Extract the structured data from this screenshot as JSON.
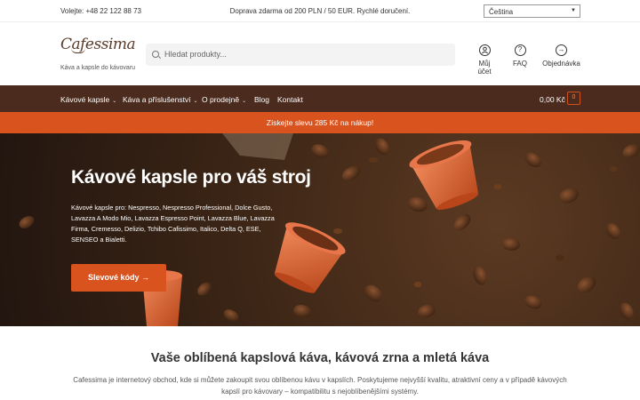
{
  "topbar": {
    "phone": "Volejte: +48 22 122 88 73",
    "shipping": "Doprava zdarma od 200 PLN / 50 EUR. Rychlé doručení.",
    "language": "Čeština"
  },
  "header": {
    "logo": "Cafessima",
    "tagline": "Káva a kapsle do kávovaru",
    "search_placeholder": "Hledat produkty...",
    "icons": [
      {
        "label": "Můj účet",
        "icon": "user-icon"
      },
      {
        "label": "FAQ",
        "icon": "question-icon"
      },
      {
        "label": "Objednávka",
        "icon": "arrow-right-icon"
      }
    ]
  },
  "nav": {
    "items": [
      {
        "label": "Kávové kapsle",
        "dropdown": true
      },
      {
        "label": "Káva a příslušenství",
        "dropdown": true
      },
      {
        "label": "O prodejně",
        "dropdown": true
      },
      {
        "label": "Blog",
        "dropdown": false
      },
      {
        "label": "Kontakt",
        "dropdown": false
      }
    ],
    "cart_total": "0,00 Kč",
    "cart_count": "0"
  },
  "promo": "Získejte slevu 285 Kč na nákup!",
  "hero": {
    "title": "Kávové kapsle pro váš stroj",
    "text": "Kávové kapsle pro: Nespresso, Nespresso Professional, Dolce Gusto, Lavazza A Modo Mio, Lavazza Espresso Point, Lavazza Blue, Lavazza Firma, Cremesso, Delizio, Tchibo Cafissimo, Italico, Delta Q, ESE, SENSEO a Bialetti.",
    "button": "Slevové kódy →"
  },
  "intro": {
    "title": "Vaše oblíbená kapslová káva, kávová zrna a mletá káva",
    "text": "Cafessima je internetový obchod, kde si můžete zakoupit svou oblíbenou kávu v kapslích. Poskytujeme nejvyšší kvalitu, atraktivní ceny a v případě kávových kapslí pro kávovary – kompatibilitu s nejoblíbenějšími systémy."
  },
  "colors": {
    "accent": "#d9531e",
    "nav_bg": "#4a2b1e",
    "brand": "#5a3a28"
  }
}
